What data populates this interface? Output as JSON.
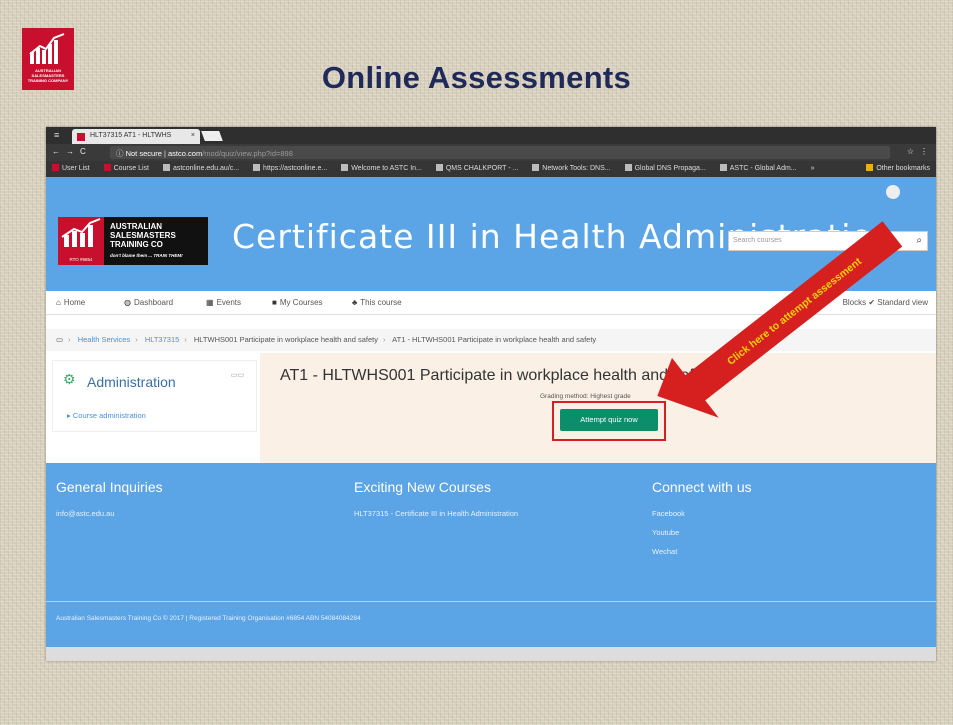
{
  "slide": {
    "title": "Online Assessments",
    "logo_text": "AUSTRALIAN SALESMASTERS TRAINING COMPANY"
  },
  "browser": {
    "tab_title": "HLT37315 AT1 - HLTWHS",
    "url_security": "Not secure",
    "url_host": "astco.com",
    "url_path": "/mod/quiz/view.php?id=898",
    "bookmarks": [
      "User List",
      "Course List",
      "astconline.edu.au/c...",
      "https://astconline.e...",
      "Welcome to ASTC In...",
      "QMS CHALKPORT - ...",
      "Network Tools: DNS...",
      "Global DNS Propaga...",
      "ASTC - Global Adm...",
      "»"
    ],
    "other_bookmarks": "Other bookmarks"
  },
  "site": {
    "logo_name": "AUSTRALIAN SALESMASTERS TRAINING CO",
    "logo_tagline": "don't blame them ... TRAIN THEM!",
    "logo_rto": "RTO #6854",
    "course_title": "Certificate III in Health Administration",
    "search_placeholder": "Search courses",
    "nav": {
      "home": "Home",
      "dashboard": "Dashboard",
      "events": "Events",
      "my_courses": "My Courses",
      "this_course": "This course",
      "blocks": "Blocks",
      "standard_view": "Standard view"
    },
    "breadcrumb": [
      "Health Services",
      "HLT37315",
      "HLTWHS001 Participate in workplace health and safety",
      "AT1 - HLTWHS001 Participate in workplace health and safety"
    ],
    "admin_block": {
      "title": "Administration",
      "item": "Course administration"
    },
    "quiz": {
      "title": "AT1 - HLTWHS001 Participate in workplace health and safety",
      "grading": "Grading method: Highest grade",
      "attempt_button": "Attempt quiz now"
    },
    "footer": {
      "col1_title": "General Inquiries",
      "col1_text": "info@astc.edu.au",
      "col2_title": "Exciting New Courses",
      "col2_text": "HLT37315 - Certificate III in Health Administration",
      "col3_title": "Connect with us",
      "col3_links": [
        "Facebook",
        "Youtube",
        "Wechat"
      ],
      "copyright": "Australian Salesmasters Training Co © 2017 | Registered Training Organisation #6854 ABN 54084084284"
    }
  },
  "annotation": {
    "arrow_text": "Click here to attempt assessment",
    "arrow_color": "#d62020",
    "arrow_text_color": "#f5d100"
  }
}
